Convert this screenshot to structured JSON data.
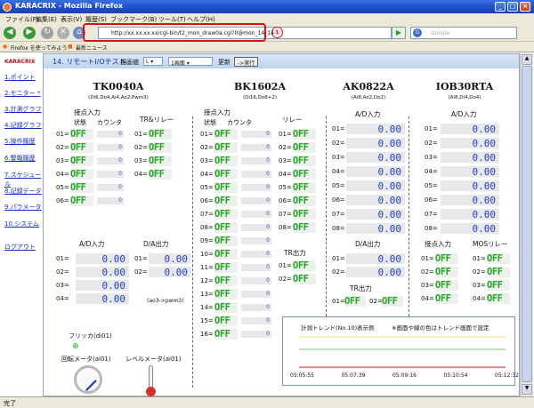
{
  "window": {
    "title": "KARACRIX - Mozilla Firefox",
    "min": "_",
    "max": "□",
    "close": "×"
  },
  "menu": [
    "ファイル(F)",
    "編集(E)",
    "表示(V)",
    "履歴(S)",
    "ブックマーク(B)",
    "ツール(T)",
    "ヘルプ(H)"
  ],
  "nav": {
    "url": "http://xx.xx.xx.xx/cgi-bin/t2_mon_draw0a.cgi?0@mon_14_14",
    "annotation": "①",
    "search_placeholder": "Google"
  },
  "bookmarks": [
    "Firefox を使ってみよう",
    "最新ニュース"
  ],
  "sidebar": {
    "brand": "KARACRIX",
    "items": [
      "1.ポイント",
      "2.モニター *",
      "3.計測グラフ",
      "4.記録グラフ",
      "5.操作履歴",
      "6.警報履歴",
      "7.スケジュール",
      "8.記録データ",
      "9.パラメータ",
      "10.システム",
      "ログアウト"
    ]
  },
  "page": {
    "title": "14. リモートI/Oテスト",
    "draw_label": "描画値",
    "draw_value": "L",
    "screen_value": "1画面",
    "update_label": "更新",
    "run_label": "->実行"
  },
  "tk": {
    "title": "TK0040A",
    "sub": "(Di6,Do4,Ai4,Ao2,Pwm3)",
    "di_label": "接点入力",
    "state_label": "状態",
    "count_label": "カウンタ",
    "relay_label": "TR&リレー",
    "di": [
      {
        "n": "01=",
        "v": "OFF",
        "c": "0"
      },
      {
        "n": "02=",
        "v": "OFF",
        "c": "0"
      },
      {
        "n": "03=",
        "v": "OFF",
        "c": "0"
      },
      {
        "n": "04=",
        "v": "OFF",
        "c": "0"
      },
      {
        "n": "05=",
        "v": "OFF",
        "c": "0"
      },
      {
        "n": "06=",
        "v": "OFF",
        "c": "0"
      }
    ],
    "relay": [
      {
        "n": "01=",
        "v": "OFF"
      },
      {
        "n": "02=",
        "v": "OFF"
      },
      {
        "n": "03=",
        "v": "OFF"
      },
      {
        "n": "04=",
        "v": "OFF"
      }
    ],
    "ad_label": "A/D入力",
    "da_label": "D/A出力",
    "ad": [
      {
        "n": "01=",
        "v": "0.00"
      },
      {
        "n": "02=",
        "v": "0.00"
      },
      {
        "n": "03=",
        "v": "0.00"
      },
      {
        "n": "04=",
        "v": "0.00"
      }
    ],
    "da": [
      {
        "n": "01=",
        "v": "0.00"
      },
      {
        "n": "02=",
        "v": "0.00"
      }
    ],
    "pwm_note": "(ao3->pwm3)",
    "flicker_label": "フリッカ(di01)",
    "rot_label": "回転メータ(ai01)",
    "level_label": "レベルメータ(ai01)"
  },
  "bk": {
    "title": "BK1602A",
    "sub": "(Di16,Do8+2)",
    "di_label": "接点入力",
    "state_label": "状態",
    "count_label": "カウンタ",
    "relay_label": "リレー",
    "di": [
      {
        "n": "01=",
        "v": "OFF",
        "c": "0"
      },
      {
        "n": "02=",
        "v": "OFF",
        "c": "0"
      },
      {
        "n": "03=",
        "v": "OFF",
        "c": "0"
      },
      {
        "n": "04=",
        "v": "OFF",
        "c": "0"
      },
      {
        "n": "05=",
        "v": "OFF",
        "c": "0"
      },
      {
        "n": "06=",
        "v": "OFF",
        "c": "0"
      },
      {
        "n": "07=",
        "v": "OFF",
        "c": "0"
      },
      {
        "n": "08=",
        "v": "OFF",
        "c": "0"
      },
      {
        "n": "09=",
        "v": "OFF",
        "c": "0"
      },
      {
        "n": "10=",
        "v": "OFF",
        "c": "0"
      },
      {
        "n": "11=",
        "v": "OFF",
        "c": "0"
      },
      {
        "n": "12=",
        "v": "OFF",
        "c": "0"
      },
      {
        "n": "13=",
        "v": "OFF",
        "c": "0"
      },
      {
        "n": "14=",
        "v": "OFF",
        "c": "0"
      },
      {
        "n": "15=",
        "v": "OFF",
        "c": "0"
      },
      {
        "n": "16=",
        "v": "OFF",
        "c": "0"
      }
    ],
    "relay": [
      {
        "n": "01=",
        "v": "OFF"
      },
      {
        "n": "02=",
        "v": "OFF"
      },
      {
        "n": "03=",
        "v": "OFF"
      },
      {
        "n": "04=",
        "v": "OFF"
      },
      {
        "n": "05=",
        "v": "OFF"
      },
      {
        "n": "06=",
        "v": "OFF"
      },
      {
        "n": "07=",
        "v": "OFF"
      },
      {
        "n": "08=",
        "v": "OFF"
      }
    ],
    "tr_label": "TR出力",
    "tr": [
      {
        "n": "01=",
        "v": "OFF"
      },
      {
        "n": "02=",
        "v": "OFF"
      }
    ]
  },
  "ak": {
    "title": "AK0822A",
    "sub": "(Ai8,Ao2,Do2)",
    "ad_label": "A/D入力",
    "ad": [
      {
        "n": "01=",
        "v": "0.00"
      },
      {
        "n": "02=",
        "v": "0.00"
      },
      {
        "n": "03=",
        "v": "0.00"
      },
      {
        "n": "04=",
        "v": "0.00"
      },
      {
        "n": "05=",
        "v": "0.00"
      },
      {
        "n": "06=",
        "v": "0.00"
      },
      {
        "n": "07=",
        "v": "0.00"
      },
      {
        "n": "08=",
        "v": "0.00"
      }
    ],
    "da_label": "D/A出力",
    "da": [
      {
        "n": "01=",
        "v": "0.00"
      },
      {
        "n": "02=",
        "v": "0.00"
      }
    ],
    "tr_label": "TR出力",
    "tr": [
      {
        "n": "01=",
        "v": "OFF"
      },
      {
        "n": "02=",
        "v": "OFF"
      }
    ]
  },
  "io": {
    "title": "IOB30RTA",
    "sub": "(Ai8,Di4,Do4)",
    "ad_label": "A/D入力",
    "ad": [
      {
        "n": "01=",
        "v": "0.00"
      },
      {
        "n": "02=",
        "v": "0.00"
      },
      {
        "n": "03=",
        "v": "0.00"
      },
      {
        "n": "04=",
        "v": "0.00"
      },
      {
        "n": "05=",
        "v": "0.00"
      },
      {
        "n": "06=",
        "v": "0.00"
      },
      {
        "n": "07=",
        "v": "0.00"
      },
      {
        "n": "08=",
        "v": "0.00"
      }
    ],
    "di_label": "接点入力",
    "mos_label": "MOSリレー",
    "di": [
      {
        "n": "01=",
        "v": "OFF"
      },
      {
        "n": "02=",
        "v": "OFF"
      },
      {
        "n": "03=",
        "v": "OFF"
      },
      {
        "n": "04=",
        "v": "OFF"
      }
    ],
    "mos": [
      {
        "n": "01=",
        "v": "OFF"
      },
      {
        "n": "02=",
        "v": "OFF"
      },
      {
        "n": "03=",
        "v": "OFF"
      },
      {
        "n": "04=",
        "v": "OFF"
      }
    ]
  },
  "trend": {
    "title": "計測トレンド(No.10)表示例",
    "note": "※画面や線の色はトレンド画面で設定",
    "times": [
      "05:05:55",
      "05:07:39",
      "05:09:16",
      "05:10:54",
      "05:12:32"
    ],
    "colors": {
      "yellow": "#e8e070",
      "green": "#80c880",
      "red": "#e04040"
    }
  },
  "status": "完了"
}
